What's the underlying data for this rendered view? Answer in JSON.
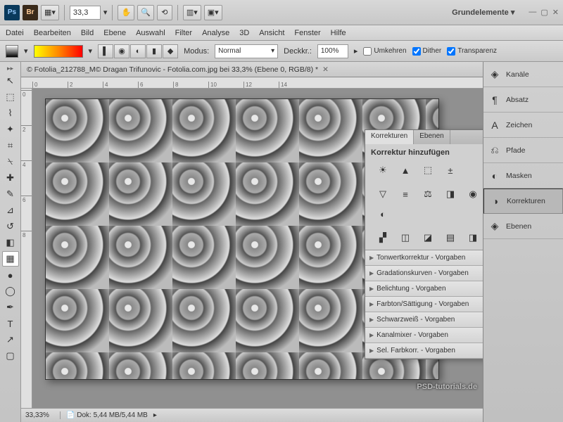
{
  "topbar": {
    "zoom": "33,3",
    "workspace": "Grundelemente ▾"
  },
  "menu": [
    "Datei",
    "Bearbeiten",
    "Bild",
    "Ebene",
    "Auswahl",
    "Filter",
    "Analyse",
    "3D",
    "Ansicht",
    "Fenster",
    "Hilfe"
  ],
  "options": {
    "modus_label": "Modus:",
    "modus_value": "Normal",
    "deckkr_label": "Deckkr.:",
    "deckkr_value": "100%",
    "umkehren": "Umkehren",
    "dither": "Dither",
    "transparenz": "Transparenz"
  },
  "document": {
    "title": "© Fotolia_212788_M© Dragan Trifunovic - Fotolia.com.jpg bei 33,3% (Ebene 0, RGB/8) *"
  },
  "ruler_h": [
    "0",
    "2",
    "4",
    "6",
    "8",
    "10",
    "12",
    "14"
  ],
  "ruler_v": [
    "0",
    "2",
    "4",
    "6",
    "8"
  ],
  "status": {
    "zoom": "33,33%",
    "doc": "Dok: 5,44 MB/5,44 MB"
  },
  "adjustments": {
    "tabs": [
      "Korrekturen",
      "Ebenen"
    ],
    "header": "Korrektur hinzufügen",
    "icons": [
      "brightness",
      "levels",
      "curves",
      "exposure",
      "vibrance",
      "hue",
      "balance",
      "bw",
      "photo",
      "mixer",
      "channelmix",
      "invert",
      "posterize",
      "threshold",
      "gradientmap"
    ],
    "presets": [
      "Tonwertkorrektur - Vorgaben",
      "Gradationskurven - Vorgaben",
      "Belichtung - Vorgaben",
      "Farbton/Sättigung - Vorgaben",
      "Schwarzweiß - Vorgaben",
      "Kanalmixer - Vorgaben",
      "Sel. Farbkorr. - Vorgaben"
    ]
  },
  "rail": [
    {
      "icon": "◈",
      "label": "Kanäle"
    },
    {
      "icon": "¶",
      "label": "Absatz"
    },
    {
      "icon": "A",
      "label": "Zeichen"
    },
    {
      "icon": "⎌",
      "label": "Pfade"
    },
    {
      "icon": "◐",
      "label": "Masken"
    },
    {
      "icon": "◑",
      "label": "Korrekturen"
    },
    {
      "icon": "◈",
      "label": "Ebenen"
    }
  ],
  "watermark": "PSD-tutorials.de"
}
